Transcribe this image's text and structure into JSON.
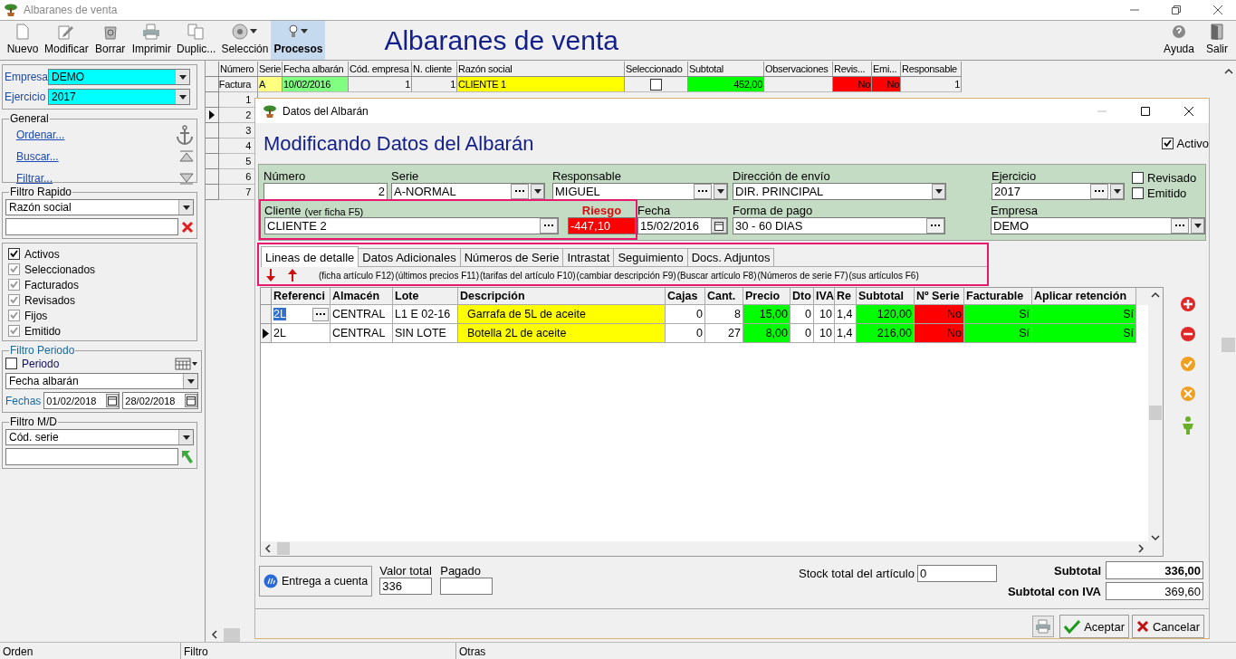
{
  "window": {
    "title": "Albaranes de venta"
  },
  "toolbar": {
    "buttons": [
      {
        "label": "Nuevo",
        "kind": "new",
        "selected": false,
        "menu": false
      },
      {
        "label": "Modificar",
        "kind": "edit",
        "selected": false,
        "menu": false
      },
      {
        "label": "Borrar",
        "kind": "delete",
        "selected": false,
        "menu": false
      },
      {
        "label": "Imprimir",
        "kind": "print",
        "selected": false,
        "menu": false
      },
      {
        "label": "Duplic...",
        "kind": "duplicate",
        "selected": false,
        "menu": false
      },
      {
        "label": "Selección",
        "kind": "selection",
        "selected": false,
        "menu": true
      },
      {
        "label": "Procesos",
        "kind": "processes",
        "selected": true,
        "menu": true
      }
    ],
    "heading": "Albaranes de venta",
    "right_buttons": [
      {
        "label": "Ayuda",
        "kind": "help"
      },
      {
        "label": "Salir",
        "kind": "exit"
      }
    ]
  },
  "sidebar": {
    "empresa": {
      "label": "Empresa",
      "value": "DEMO"
    },
    "ejercicio": {
      "label": "Ejercicio",
      "value": "2017"
    },
    "general": {
      "title": "General",
      "links": [
        {
          "label": "Ordenar...",
          "kind": "anchor"
        },
        {
          "label": "Buscar...",
          "kind": "top"
        },
        {
          "label": "Filtrar...",
          "kind": "bottom"
        }
      ]
    },
    "quick_filter": {
      "title": "Filtro Rapido",
      "field": "Razón social"
    },
    "checks": [
      {
        "label": "Activos",
        "checked": true,
        "disabled": false
      },
      {
        "label": "Seleccionados",
        "checked": true,
        "disabled": true
      },
      {
        "label": "Facturados",
        "checked": true,
        "disabled": true
      },
      {
        "label": "Revisados",
        "checked": true,
        "disabled": true
      },
      {
        "label": "Fijos",
        "checked": true,
        "disabled": true
      },
      {
        "label": "Emitido",
        "checked": true,
        "disabled": true
      }
    ],
    "period": {
      "title": "Filtro Periodo",
      "checkbox": {
        "label": "Periodo",
        "checked": false
      },
      "field": "Fecha albarán",
      "dates_label": "Fechas",
      "from": "01/02/2018",
      "to": "28/02/2018"
    },
    "md_filter": {
      "title": "Filtro M/D",
      "field": "Cód. serie"
    }
  },
  "grid": {
    "columns": [
      "Número",
      "Serie",
      "Fecha albarán",
      "Cód. empresa",
      "N. cliente",
      "Razón social",
      "Seleccionado",
      "Subtotal",
      "Observaciones",
      "Revis...",
      "Emi...",
      "Responsable"
    ],
    "rows": [
      {
        "current": false,
        "cells": [
          {
            "kind": "text",
            "text": "Factura"
          },
          {
            "kind": "text",
            "text": "A",
            "color": "#ffff80"
          },
          {
            "kind": "text",
            "text": "10/02/2016",
            "color": "#80ff80"
          },
          {
            "kind": "text",
            "text": "1"
          },
          {
            "kind": "text",
            "text": "1"
          },
          {
            "kind": "text",
            "text": "CLIENTE 1",
            "color": "#ffff00"
          },
          {
            "kind": "checkbox",
            "checked": false
          },
          {
            "kind": "text",
            "text": "452,00",
            "color": "#00ff00"
          },
          {
            "kind": "blank"
          },
          {
            "kind": "text",
            "text": "No",
            "color": "#ff0000"
          },
          {
            "kind": "text",
            "text": "No",
            "color": "#ff0000"
          },
          {
            "kind": "text",
            "text": "1"
          }
        ]
      },
      {
        "current": false,
        "cells": [
          {
            "kind": "text",
            "text": "1"
          }
        ]
      },
      {
        "current": true,
        "cells": [
          {
            "kind": "text",
            "text": "2"
          }
        ]
      },
      {
        "current": false,
        "cells": [
          {
            "kind": "text",
            "text": "3"
          }
        ]
      },
      {
        "current": false,
        "cells": [
          {
            "kind": "text",
            "text": "4"
          }
        ]
      },
      {
        "current": false,
        "cells": [
          {
            "kind": "text",
            "text": "5"
          }
        ]
      },
      {
        "current": false,
        "cells": [
          {
            "kind": "text",
            "text": "6"
          }
        ]
      },
      {
        "current": false,
        "cells": [
          {
            "kind": "text",
            "text": "7"
          }
        ]
      }
    ]
  },
  "dialog": {
    "title": "Datos del Albarán",
    "heading": "Modificando Datos del Albarán",
    "activo": {
      "label": "Activo",
      "checked": true
    },
    "numero": {
      "label": "Número",
      "value": "2"
    },
    "serie": {
      "label": "Serie",
      "value": "A-NORMAL"
    },
    "responsable": {
      "label": "Responsable",
      "value": "MIGUEL"
    },
    "direccion": {
      "label": "Dirección de envío",
      "value": "DIR. PRINCIPAL"
    },
    "ejercicio": {
      "label": "Ejercicio",
      "value": "2017"
    },
    "revisado": {
      "label": "Revisado",
      "checked": false
    },
    "emitido": {
      "label": "Emitido",
      "checked": false
    },
    "cliente_group": {
      "highlighted": true,
      "cliente": {
        "label": "Cliente",
        "hint": "(ver ficha F5)",
        "value": "CLIENTE 2"
      },
      "riesgo": {
        "label": "Riesgo",
        "value": "-447,10"
      }
    },
    "fecha": {
      "label": "Fecha",
      "value": "15/02/2016"
    },
    "forma_pago": {
      "label": "Forma de pago",
      "value": "30 - 60 DIAS"
    },
    "empresa": {
      "label": "Empresa",
      "value": "DEMO"
    },
    "tabs_section": {
      "highlighted": true,
      "tabs": [
        {
          "label": "Lineas de detalle",
          "selected": true
        },
        {
          "label": "Datos Adicionales",
          "selected": false
        },
        {
          "label": "Números de Serie",
          "selected": false
        },
        {
          "label": "Intrastat",
          "selected": false
        },
        {
          "label": "Seguimiento",
          "selected": false
        },
        {
          "label": "Docs. Adjuntos",
          "selected": false
        }
      ],
      "shortcuts": [
        "(ficha artículo F12)",
        "(últimos precios F11)",
        "(tarifas del artículo F10)",
        "(cambiar descripción F9)",
        "(Buscar artículo F8)",
        "(Números de serie F7)",
        "(sus artículos F6)"
      ]
    },
    "lines": {
      "columns": [
        "Referenci",
        "Almacén",
        "Lote",
        "Descripción",
        "Cajas",
        "Cant.",
        "Precio",
        "Dto",
        "IVA",
        "Re",
        "Subtotal",
        "Nº Serie",
        "Facturable",
        "Aplicar retención"
      ],
      "rows": [
        {
          "current": false,
          "cells": [
            {
              "text": "2L",
              "kind": "editing"
            },
            {
              "text": "CENTRAL"
            },
            {
              "text": "L1 E 02-16"
            },
            {
              "text": "Garrafa de 5L de aceite",
              "color": "#ffff00"
            },
            {
              "text": "0"
            },
            {
              "text": "8"
            },
            {
              "text": "15,00",
              "color": "#00ff00"
            },
            {
              "text": "0"
            },
            {
              "text": "10"
            },
            {
              "text": "1,4"
            },
            {
              "text": "120,00",
              "color": "#00ff00"
            },
            {
              "text": "No",
              "color": "#ff0000"
            },
            {
              "text": "Sí",
              "color": "#00ff00"
            },
            {
              "text": "Sí",
              "color": "#00ff00"
            }
          ]
        },
        {
          "current": true,
          "cells": [
            {
              "text": "2L"
            },
            {
              "text": "CENTRAL"
            },
            {
              "text": "SIN LOTE"
            },
            {
              "text": "Botella 2L de aceite",
              "color": "#ffff00"
            },
            {
              "text": "0"
            },
            {
              "text": "27"
            },
            {
              "text": "8,00",
              "color": "#00ff00"
            },
            {
              "text": "0"
            },
            {
              "text": "10"
            },
            {
              "text": "1,4"
            },
            {
              "text": "216,00",
              "color": "#00ff00"
            },
            {
              "text": "No",
              "color": "#ff0000"
            },
            {
              "text": "Sí",
              "color": "#00ff00"
            },
            {
              "text": "Sí",
              "color": "#00ff00"
            }
          ]
        }
      ]
    },
    "entrega_button": "Entrega a cuenta",
    "valor_total": {
      "label": "Valor total",
      "value": "336"
    },
    "pagado": {
      "label": "Pagado"
    },
    "stock": {
      "label": "Stock total del artículo",
      "value": "0"
    },
    "subtotal": {
      "label": "Subtotal",
      "value": "336,00"
    },
    "subtotal_iva": {
      "label": "Subtotal con IVA",
      "value": "369,60"
    },
    "buttons": [
      {
        "label": "Aceptar",
        "kind": "accept"
      },
      {
        "label": "Cancelar",
        "kind": "cancel"
      }
    ]
  },
  "status_bar": [
    "Orden",
    "Filtro",
    "Otras"
  ]
}
